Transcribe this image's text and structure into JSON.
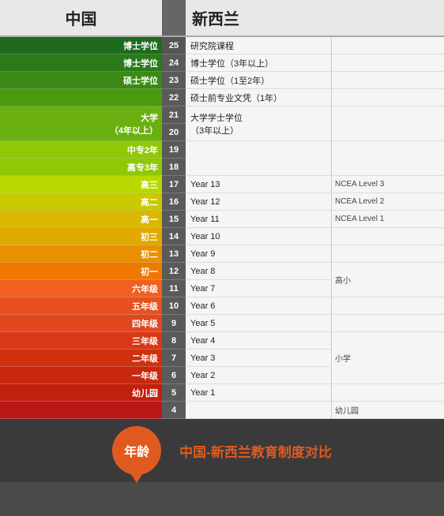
{
  "header": {
    "china_label": "中国",
    "nz_label": "新西兰"
  },
  "rows": [
    {
      "age": "25",
      "china": "博士学位",
      "nz": "研究院课程",
      "ncea": "",
      "bg": "bg-25",
      "chinaSpan": 1,
      "nzSpan": 1
    },
    {
      "age": "24",
      "china": "博士学位",
      "nz": "博士学位（3年以上）",
      "ncea": "",
      "bg": "bg-24",
      "chinaSpan": 1,
      "nzSpan": 1
    },
    {
      "age": "23",
      "china": "硕士学位",
      "nz": "硕士学位（1至2年）",
      "ncea": "",
      "bg": "bg-23",
      "chinaSpan": 1,
      "nzSpan": 1
    },
    {
      "age": "22",
      "china": "",
      "nz": "硕士前专业文凭（1年）",
      "ncea": "",
      "bg": "bg-22",
      "chinaSpan": 1,
      "nzSpan": 1
    },
    {
      "age": "21",
      "china": "大学",
      "nz": "大学学士学位",
      "ncea": "",
      "bg": "bg-2120",
      "chinaSpan": 2,
      "nzSpan": 2
    },
    {
      "age": "20",
      "china": "（4年以上）",
      "nz": "（3年以上）",
      "ncea": "",
      "bg": "bg-2120",
      "chinaSpan": 0,
      "nzSpan": 0
    },
    {
      "age": "19",
      "china": "中专2年",
      "nz": "",
      "ncea": "",
      "bg": "bg-1918",
      "chinaSpan": 1,
      "nzSpan": 2
    },
    {
      "age": "18",
      "china": "高专3年",
      "nz": "",
      "ncea": "",
      "bg": "bg-1918",
      "chinaSpan": 1,
      "nzSpan": 0
    },
    {
      "age": "17",
      "china": "高三",
      "nz": "Year 13",
      "ncea": "NCEA Level 3",
      "bg": "bg-17",
      "chinaSpan": 1,
      "nzSpan": 1
    },
    {
      "age": "16",
      "china": "高二",
      "nz": "Year 12",
      "ncea": "NCEA Level 2",
      "bg": "bg-16",
      "chinaSpan": 1,
      "nzSpan": 1
    },
    {
      "age": "15",
      "china": "高一",
      "nz": "Year 11",
      "ncea": "NCEA Level 1",
      "bg": "bg-15",
      "chinaSpan": 1,
      "nzSpan": 1
    },
    {
      "age": "14",
      "china": "初三",
      "nz": "Year 10",
      "ncea": "",
      "bg": "bg-14",
      "chinaSpan": 1,
      "nzSpan": 1
    },
    {
      "age": "13",
      "china": "初二",
      "nz": "Year 9",
      "ncea": "",
      "bg": "bg-13",
      "chinaSpan": 1,
      "nzSpan": 1
    },
    {
      "age": "12",
      "china": "初一",
      "nz": "Year 8",
      "ncea": "高小",
      "bg": "bg-12",
      "chinaSpan": 1,
      "nzSpan": 1
    },
    {
      "age": "11",
      "china": "六年级",
      "nz": "Year 7",
      "ncea": "",
      "bg": "bg-11",
      "chinaSpan": 1,
      "nzSpan": 1
    },
    {
      "age": "10",
      "china": "五年级",
      "nz": "Year 6",
      "ncea": "",
      "bg": "bg-10",
      "chinaSpan": 1,
      "nzSpan": 1
    },
    {
      "age": "9",
      "china": "四年级",
      "nz": "Year 5",
      "ncea": "",
      "bg": "bg-9",
      "chinaSpan": 1,
      "nzSpan": 1
    },
    {
      "age": "8",
      "china": "三年级",
      "nz": "Year 4",
      "ncea": "小学",
      "bg": "bg-8",
      "chinaSpan": 1,
      "nzSpan": 1
    },
    {
      "age": "7",
      "china": "二年级",
      "nz": "Year 3",
      "ncea": "",
      "bg": "bg-7",
      "chinaSpan": 1,
      "nzSpan": 1
    },
    {
      "age": "6",
      "china": "一年级",
      "nz": "Year 2",
      "ncea": "",
      "bg": "bg-6",
      "chinaSpan": 1,
      "nzSpan": 1
    },
    {
      "age": "5",
      "china": "幼儿园",
      "nz": "Year 1",
      "ncea": "",
      "bg": "bg-5",
      "chinaSpan": 1,
      "nzSpan": 1
    },
    {
      "age": "4",
      "china": "",
      "nz": "",
      "ncea": "幼儿园",
      "bg": "bg-4",
      "chinaSpan": 1,
      "nzSpan": 1
    }
  ],
  "footer": {
    "age_label": "年龄",
    "title": "中国-新西兰教育制度对比"
  }
}
